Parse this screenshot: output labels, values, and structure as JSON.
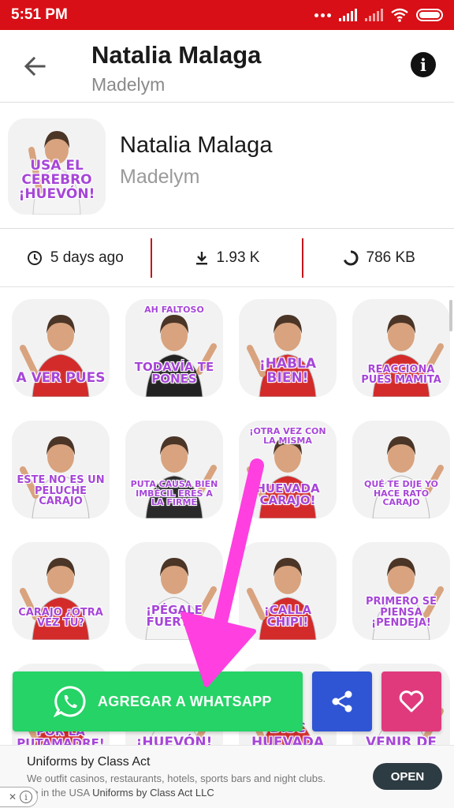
{
  "status_bar": {
    "time": "5:51 PM"
  },
  "app_bar": {
    "title": "Natalia Malaga",
    "subtitle": "Madelym"
  },
  "pack": {
    "title": "Natalia Malaga",
    "author": "Madelym",
    "tray_caption": "USA EL CEREBRO ¡HUEVÓN!"
  },
  "stats": {
    "updated": "5 days ago",
    "downloads": "1.93 K",
    "size": "786 KB"
  },
  "stickers": [
    {
      "caption": "A VER PUES",
      "shirt": "#d32a2a"
    },
    {
      "caption_top": "AH FALTOSO",
      "caption": "TODAVÍA TE PONES",
      "shirt": "#222222"
    },
    {
      "caption": "¡HABLA BIEN!",
      "shirt": "#d32a2a"
    },
    {
      "caption": "REACCIONA PUES MAMITA",
      "shirt": "#d32a2a"
    },
    {
      "caption": "ESTE NO ES UN PELUCHE CARAJO",
      "shirt": "#f4f4f4"
    },
    {
      "caption": "PUTA CAUSA BIEN IMBÉCIL ERES A LA FIRME",
      "shirt": "#2a2a2a"
    },
    {
      "caption_top": "¡OTRA VEZ CON LA MISMA",
      "caption": "HUEVADA CARAJO!",
      "shirt": "#d32a2a"
    },
    {
      "caption": "QUÉ TE DIJE YO HACE RATO CARAJO",
      "shirt": "#f4f4f4"
    },
    {
      "caption": "CARAJO ¿OTRA VEZ TÚ?",
      "shirt": "#d32a2a"
    },
    {
      "caption": "¡PÉGALE FUERTE!",
      "shirt": "#f4f4f4"
    },
    {
      "caption": "¡CALLA CHIPI!",
      "shirt": "#d32a2a"
    },
    {
      "caption": "PRIMERO SE PIENSA ¡PENDEJA!",
      "shirt": "#f4f4f4"
    },
    {
      "caption": "POR LA PUTAMADRE!",
      "shirt": "#d32a2a"
    },
    {
      "caption": "¡HUEVÓN!",
      "shirt": "#f4f4f4"
    },
    {
      "caption": "DISC HUEVADA",
      "shirt": "#d32a2a"
    },
    {
      "caption": "VENIR DE",
      "shirt": "#f4f4f4"
    }
  ],
  "actions": {
    "add_to_whatsapp": "AGREGAR A WHATSAPP"
  },
  "ad": {
    "title": "Uniforms by Class Act",
    "text": "We outfit casinos, restaurants, hotels, sports bars and night clubs.",
    "source_prefix": "de in the USA",
    "source_brand": "Uniforms by Class Act LLC",
    "cta": "OPEN"
  },
  "colors": {
    "status_bar": "#d80f16",
    "whatsapp_green": "#25d366",
    "share_blue": "#2f55d4",
    "favorite_pink": "#e03a7d",
    "caption_purple": "#a646d8",
    "annotation_arrow": "#ff3fe0"
  },
  "icons": [
    "back-arrow-icon",
    "info-icon",
    "clock-icon",
    "download-icon",
    "size-ring-icon",
    "whatsapp-icon",
    "share-icon",
    "heart-icon",
    "adchoices-icon"
  ]
}
